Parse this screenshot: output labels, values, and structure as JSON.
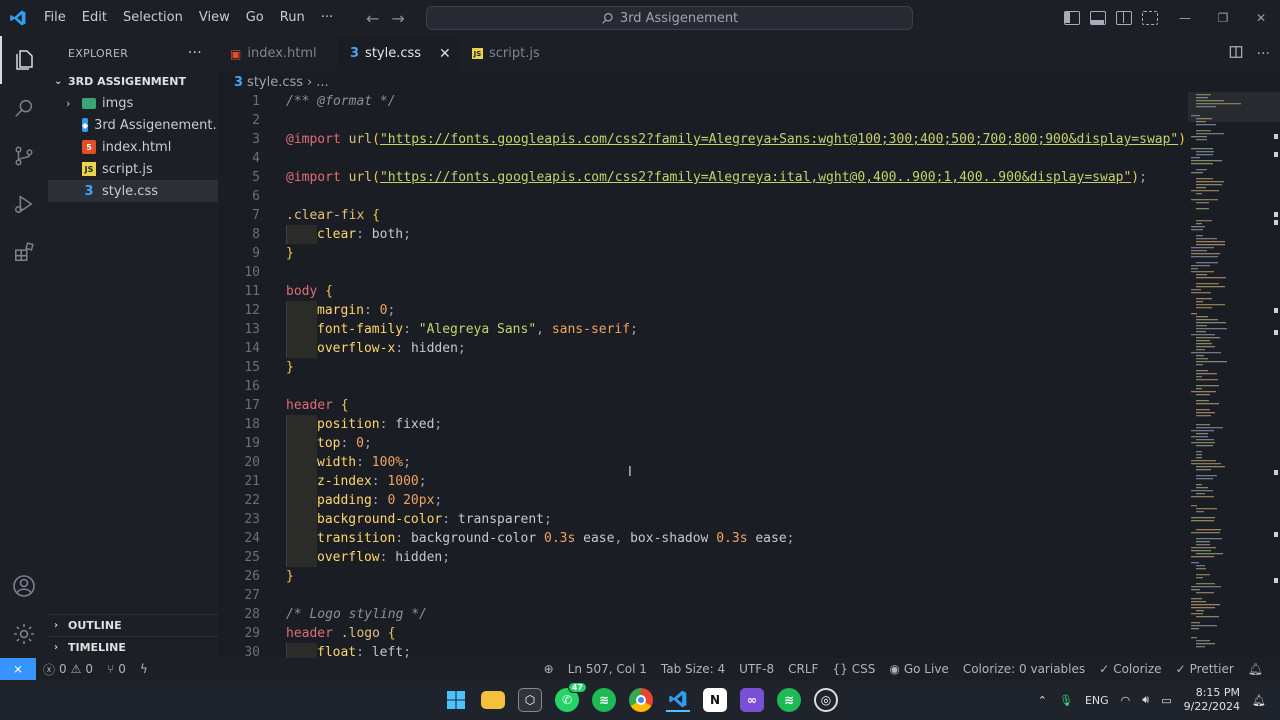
{
  "menu": [
    "File",
    "Edit",
    "Selection",
    "View",
    "Go",
    "Run",
    "···"
  ],
  "search": {
    "text": "3rd Assigenement"
  },
  "sidebar": {
    "title": "EXPLORER",
    "more": "···",
    "folder": "3RD ASSIGENMENT",
    "items": [
      {
        "label": "imgs",
        "icon": "folder-images-icon"
      },
      {
        "label": "3rd Assigenement...",
        "icon": "vscode-workspace-icon"
      },
      {
        "label": "index.html",
        "icon": "html-file-icon"
      },
      {
        "label": "script.js",
        "icon": "js-file-icon"
      },
      {
        "label": "style.css",
        "icon": "css-file-icon"
      }
    ],
    "outline": "OUTLINE",
    "timeline": "TIMELINE"
  },
  "tabs": [
    {
      "label": "index.html",
      "icon": "html-file-icon"
    },
    {
      "label": "style.css",
      "icon": "css-file-icon"
    },
    {
      "label": "script.js",
      "icon": "js-file-icon"
    }
  ],
  "breadcrumb": {
    "file": "style.css",
    "sep": "›",
    "rest": "..."
  },
  "code": {
    "line_numbers": [
      "1",
      "2",
      "3",
      "4",
      "5",
      "6",
      "7",
      "8",
      "9",
      "10",
      "11",
      "12",
      "13",
      "14",
      "15",
      "16",
      "17",
      "18",
      "19",
      "20",
      "21",
      "22",
      "23",
      "24",
      "25",
      "26",
      "27",
      "28",
      "29",
      "30"
    ],
    "l1": "/** @format */",
    "l3_kw": "@import",
    "l3_fn": "url",
    "l3_str": "\"https://fonts.googleapis.com/css2?family=Alegreya+Sans:wght@100;300;400;500;700;800;900&display=swap\"",
    "l5_str": "\"https://fonts.googleapis.com/css2?family=Alegreya:ital,wght@0,400..900;1,400..900&display=swap\"",
    "sel_clearfix": ".clear-fix",
    "sel_body": "body",
    "sel_header": "header",
    "sel_logo": ".logo",
    "p_clear": "clear",
    "v_both": "both",
    "p_margin": "margin",
    "p_fontfamily": "font-family",
    "v_font": "\"Alegreya Sans\"",
    "v_sansserif": "sans-serif",
    "p_overflowx": "overflow-x",
    "v_hidden": "hidden",
    "p_position": "position",
    "v_fixed": "fixed",
    "p_top": "top",
    "p_width": "width",
    "v_100": "100%",
    "p_zindex": "z-index",
    "v_1000": "1000",
    "p_padding": "padding",
    "v_pad": "0 20px",
    "p_bgcolor": "background-color",
    "v_transparent": "transparent",
    "p_transition": "transition",
    "v_tr1": "background-color",
    "v_03": "0.3s",
    "v_ease": "ease",
    "v_tr2": "box-shadow",
    "p_overflow": "overflow",
    "cm_logo": "/* Logo styling */",
    "p_float": "float",
    "v_left": "left",
    "zero": "0",
    "brace_open": "{",
    "brace_close": "}"
  },
  "status": {
    "errors": "0",
    "warnings": "0",
    "ports": "0",
    "position": "Ln 507, Col 1",
    "tabsize": "Tab Size: 4",
    "encoding": "UTF-8",
    "eol": "CRLF",
    "language": "CSS",
    "golive": "Go Live",
    "colorize_vars": "Colorize: 0 variables",
    "colorize": "Colorize",
    "prettier": "Prettier"
  },
  "taskbar": {
    "whatsapp_badge": "47",
    "lang": "ENG",
    "time": "8:15 PM",
    "date": "9/22/2024"
  },
  "colors": {
    "accent": "#3794ff",
    "bg": "#1a1d23",
    "chrome": "#1c1f26"
  }
}
